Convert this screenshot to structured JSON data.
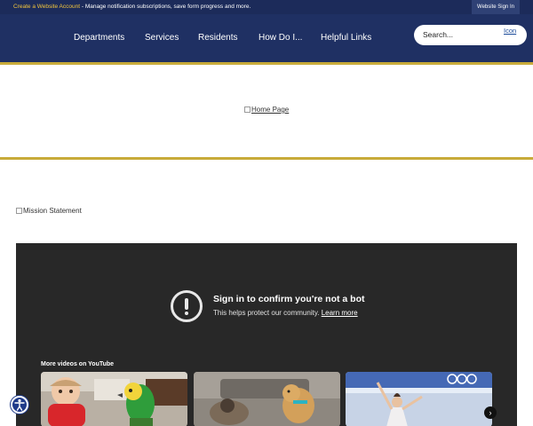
{
  "notification": {
    "link_text": "Create a Website Account",
    "message": " - Manage notification subscriptions, save form progress and more.",
    "signin_label": "Website Sign In"
  },
  "nav": {
    "items": [
      {
        "label": "Departments"
      },
      {
        "label": "Services"
      },
      {
        "label": "Residents"
      },
      {
        "label": "How Do I..."
      },
      {
        "label": "Helpful Links"
      }
    ],
    "search_placeholder": "Search...",
    "search_icon_alt": "Icon"
  },
  "home_image_alt": "Home Page",
  "mission_image_alt": "Mission Statement",
  "video": {
    "title": "Sign in to confirm you're not a bot",
    "subtitle": "This helps protect our community.",
    "learn_more": "Learn more",
    "more_videos": "More videos on YouTube"
  },
  "colors": {
    "header_navy": "#1f3063",
    "topbar_navy": "#1c2b5a",
    "gold_accent": "#c8ab3a",
    "link_yellow": "#f2c53d",
    "player_bg": "#282828"
  }
}
